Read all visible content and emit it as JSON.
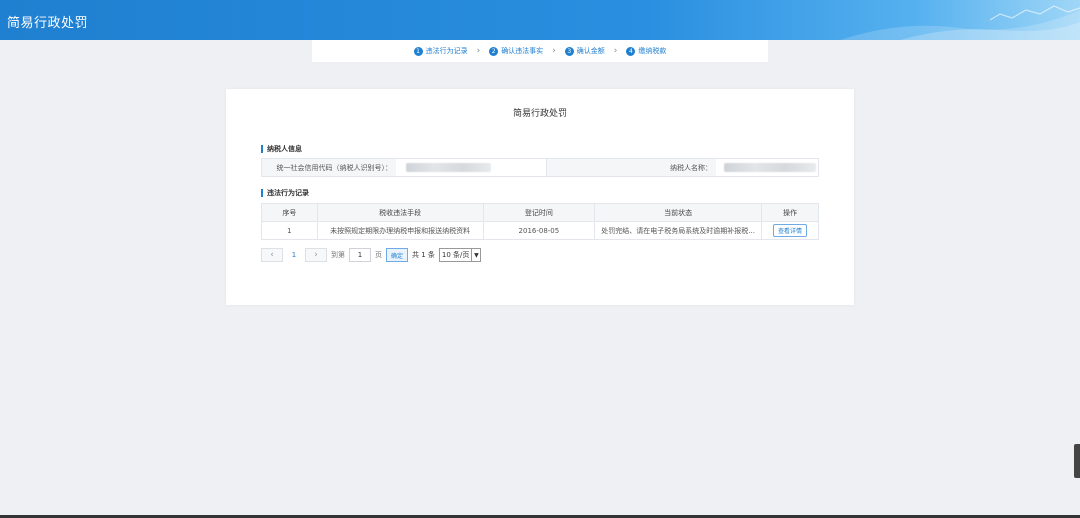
{
  "header": {
    "title": "简易行政处罚",
    "accent": "#1f7fd0"
  },
  "steps": [
    {
      "num": "1",
      "label": "违法行为记录"
    },
    {
      "num": "2",
      "label": "确认违法事实"
    },
    {
      "num": "3",
      "label": "确认金额"
    },
    {
      "num": "4",
      "label": "缴纳税款"
    }
  ],
  "card": {
    "title": "简易行政处罚",
    "taxpayer_section": "纳税人信息",
    "credit_code_label": "统一社会信用代码（纳税人识别号）：",
    "taxpayer_name_label": "纳税人名称：",
    "records_section": "违法行为记录"
  },
  "table": {
    "headers": [
      "序号",
      "税收违法手段",
      "登记时间",
      "当前状态",
      "操作"
    ],
    "rows": [
      {
        "index": "1",
        "means": "未按照规定期限办理纳税申报和报送纳税资料",
        "date": "2016-08-05",
        "status": "处罚完结、请在电子税务局系统及时逾期补报税...",
        "action": "查看详情"
      }
    ]
  },
  "pager": {
    "prev": "‹",
    "next": "›",
    "current": "1",
    "goto_label": "到第",
    "page_input": "1",
    "page_unit": "页",
    "confirm": "确定",
    "total": "共 1 条",
    "page_size": "10 条/页"
  }
}
